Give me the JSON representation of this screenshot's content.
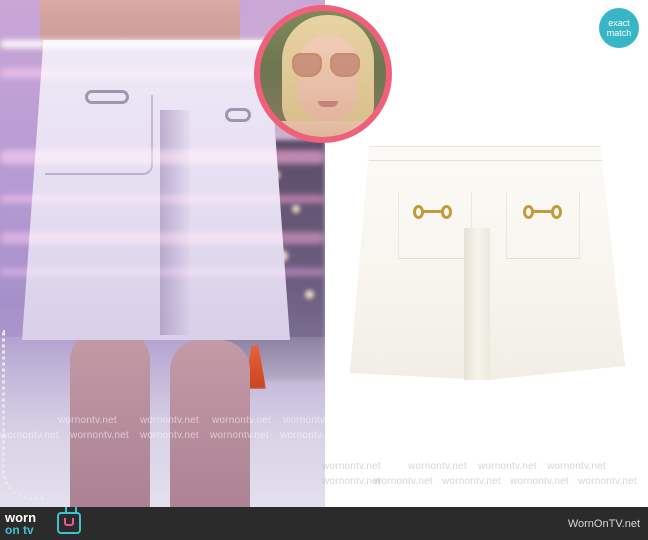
{
  "badge": {
    "line1": "exact",
    "line2": "match",
    "color": "#37b6c6"
  },
  "inset": {
    "border_color": "#f0607a"
  },
  "watermark": {
    "text": "wornontv.net"
  },
  "footer": {
    "logo_top": "worn",
    "logo_bottom": "on tv",
    "site_name": "WornOnTV.net",
    "accent": "#3fc1d4",
    "icon": "tv-hanger-icon"
  }
}
